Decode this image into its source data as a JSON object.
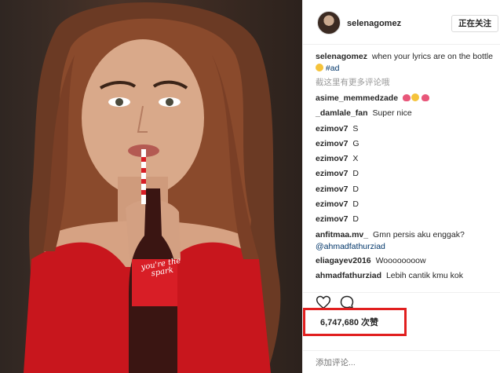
{
  "post": {
    "username": "selenagomez",
    "follow_label": "正在关注",
    "caption": {
      "user": "selenagomez",
      "text": "when your lyrics are on the bottle",
      "tag": "#ad"
    },
    "more_comments": "截这里有更多评论哦",
    "bottle_text": "you're the spark",
    "comments": [
      {
        "user": "asime_memmedzade",
        "text": ""
      },
      {
        "user": "_damlale_fan",
        "text": "Super nice"
      },
      {
        "user": "ezimov7",
        "text": "S"
      },
      {
        "user": "ezimov7",
        "text": "G"
      },
      {
        "user": "ezimov7",
        "text": "X"
      },
      {
        "user": "ezimov7",
        "text": "D"
      },
      {
        "user": "ezimov7",
        "text": "D"
      },
      {
        "user": "ezimov7",
        "text": "D"
      },
      {
        "user": "ezimov7",
        "text": "D"
      }
    ],
    "comment_anfit": {
      "user": "anfitmaa.mv_",
      "text": "Gmn persis aku enggak?",
      "mention": "@ahmadfathurziad"
    },
    "comment_elia": {
      "user": "eliagayev2016",
      "text": "Woooooooow"
    },
    "comment_ahmad": {
      "user": "ahmadfathurziad",
      "text": "Lebih cantik kmu kok"
    },
    "likes": "6,747,680 次赞",
    "add_comment_placeholder": "添加评论..."
  },
  "colors": {
    "highlight": "#e11f1f",
    "mention": "#003569",
    "muted": "#999999"
  },
  "icons": [
    "heart-icon",
    "comment-icon"
  ]
}
